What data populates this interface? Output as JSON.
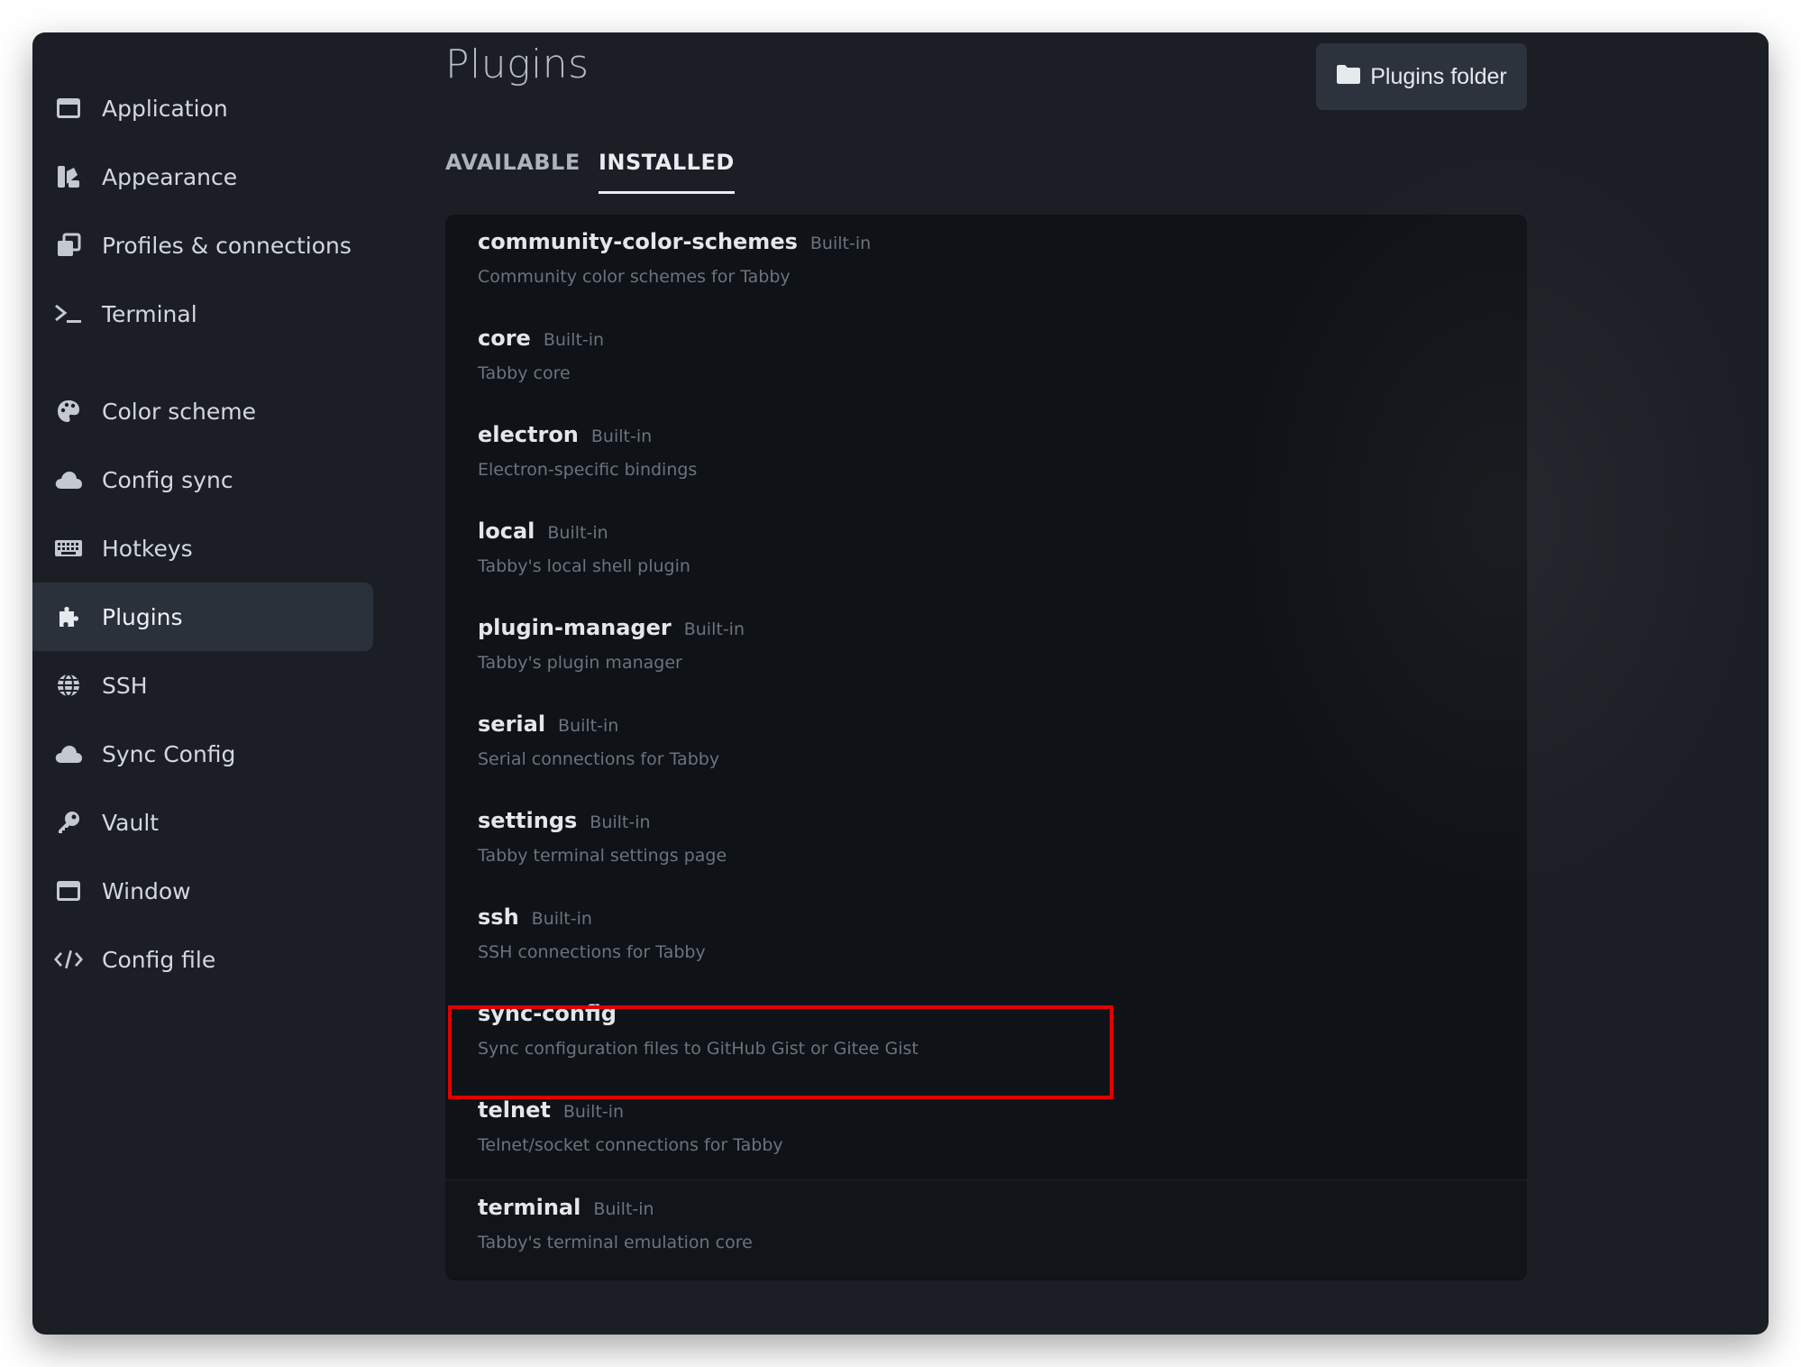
{
  "sidebar": {
    "items": [
      {
        "label": "Application",
        "icon": "window-icon"
      },
      {
        "label": "Appearance",
        "icon": "appearance-icon"
      },
      {
        "label": "Profiles & connections",
        "icon": "profiles-icon"
      },
      {
        "label": "Terminal",
        "icon": "terminal-icon"
      },
      {
        "label": "Color scheme",
        "icon": "palette-icon"
      },
      {
        "label": "Config sync",
        "icon": "cloud-icon"
      },
      {
        "label": "Hotkeys",
        "icon": "keyboard-icon"
      },
      {
        "label": "Plugins",
        "icon": "puzzle-icon",
        "active": true
      },
      {
        "label": "SSH",
        "icon": "globe-icon"
      },
      {
        "label": "Sync Config",
        "icon": "cloud-icon"
      },
      {
        "label": "Vault",
        "icon": "key-icon"
      },
      {
        "label": "Window",
        "icon": "window-icon"
      },
      {
        "label": "Config file",
        "icon": "code-icon"
      }
    ]
  },
  "main": {
    "title": "Plugins",
    "folder_button": "Plugins folder",
    "tabs": [
      {
        "label": "AVAILABLE",
        "active": false
      },
      {
        "label": "INSTALLED",
        "active": true
      }
    ],
    "plugins": [
      {
        "name": "community-color-schemes",
        "badge": "Built-in",
        "description": "Community color schemes for Tabby"
      },
      {
        "name": "core",
        "badge": "Built-in",
        "description": "Tabby core"
      },
      {
        "name": "electron",
        "badge": "Built-in",
        "description": "Electron-specific bindings"
      },
      {
        "name": "local",
        "badge": "Built-in",
        "description": "Tabby's local shell plugin"
      },
      {
        "name": "plugin-manager",
        "badge": "Built-in",
        "description": "Tabby's plugin manager"
      },
      {
        "name": "serial",
        "badge": "Built-in",
        "description": "Serial connections for Tabby"
      },
      {
        "name": "settings",
        "badge": "Built-in",
        "description": "Tabby terminal settings page"
      },
      {
        "name": "ssh",
        "badge": "Built-in",
        "description": "SSH connections for Tabby"
      },
      {
        "name": "sync-config",
        "badge": "",
        "description": "Sync configuration files to GitHub Gist or Gitee Gist"
      },
      {
        "name": "telnet",
        "badge": "Built-in",
        "description": "Telnet/socket connections for Tabby"
      },
      {
        "name": "terminal",
        "badge": "Built-in",
        "description": "Tabby's terminal emulation core"
      }
    ]
  },
  "colors": {
    "window_bg": "#1b1f25",
    "list_bg": "#0f1216",
    "active_item_bg": "#2a313a",
    "highlight": "#e10000"
  }
}
